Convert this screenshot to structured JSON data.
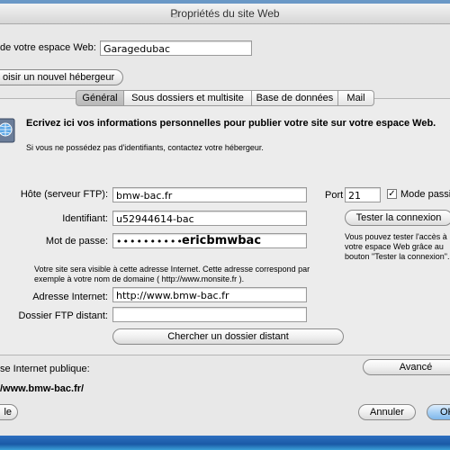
{
  "window": {
    "title": "Propriétés du site Web"
  },
  "top": {
    "site_name_label": "de votre espace Web:",
    "site_name_value": "Garagedubac",
    "choose_host_button": "oisir un nouvel hébergeur"
  },
  "tabs": [
    {
      "label": "Général",
      "active": true
    },
    {
      "label": "Sous dossiers et multisite",
      "active": false
    },
    {
      "label": "Base de données",
      "active": false
    },
    {
      "label": "Mail",
      "active": false
    }
  ],
  "general": {
    "heading": "Ecrivez ici vos informations personnelles pour publier votre site sur votre espace Web.",
    "subheading": "Si vous ne possédez pas d'identifiants, contactez votre hébergeur.",
    "ftp_host_label": "Hôte (serveur FTP):",
    "ftp_host_value": "bmw-bac.fr",
    "port_label": "Port",
    "port_value": "21",
    "passive_mode_label": "Mode passif",
    "passive_mode_checked": true,
    "identifiant_label": "Identifiant:",
    "identifiant_value": "u52944614-bac",
    "test_connection_button": "Tester la connexion",
    "password_label": "Mot de passe:",
    "password_masked": "••••••••••",
    "password_revealed": "ericbmwbac",
    "test_note": "Vous pouvez tester l'accès à votre espace Web grâce au bouton \"Tester la connexion\".",
    "url_note": "Votre site sera visible à cette adresse Internet. Cette adresse correspond par exemple à votre nom de domaine ( http://www.monsite.fr ).",
    "internet_address_label": "Adresse Internet:",
    "internet_address_value": "http://www.bmw-bac.fr",
    "remote_folder_label": "Dossier FTP distant:",
    "remote_folder_value": "",
    "browse_remote_button": "Chercher un dossier distant"
  },
  "bottom": {
    "public_address_label": "se Internet publique:",
    "public_address_value": "/www.bmw-bac.fr/",
    "advanced_button": "Avancé",
    "help_button": "le",
    "cancel_button": "Annuler",
    "ok_button": "OK"
  }
}
